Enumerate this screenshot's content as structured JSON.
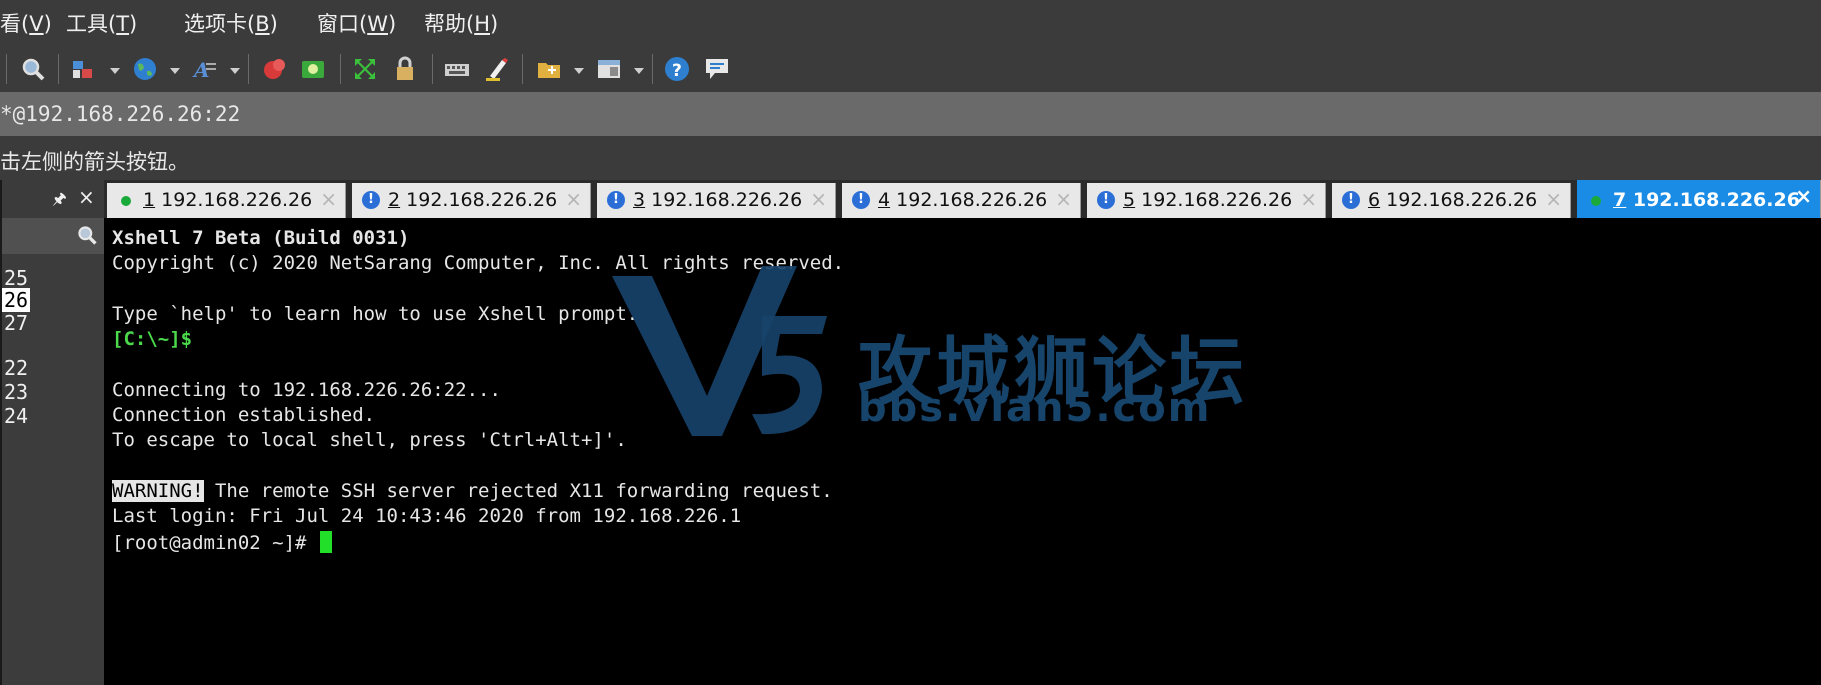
{
  "menu": {
    "items": [
      {
        "label": "看(",
        "key": "V",
        "tail": ")"
      },
      {
        "label": "工具(",
        "key": "T",
        "tail": ")"
      },
      {
        "label": "选项卡(",
        "key": "B",
        "tail": ")"
      },
      {
        "label": "窗口(",
        "key": "W",
        "tail": ")"
      },
      {
        "label": "帮助(",
        "key": "H",
        "tail": ")"
      }
    ]
  },
  "toolbar": {
    "icons": [
      "search-icon",
      "transfer-icon",
      "globe-icon",
      "font-icon",
      "xftp-icon",
      "xmanager-icon",
      "fullscreen-icon",
      "lock-icon",
      "keyboard-icon",
      "highlight-icon",
      "new-tab-icon",
      "layout-icon",
      "help-icon",
      "chat-icon"
    ]
  },
  "address": {
    "text": "*@192.168.226.26:22"
  },
  "hint": {
    "text": "击左侧的箭头按钮。"
  },
  "sidebar": {
    "pin": "📌",
    "close": "×",
    "items": [
      {
        "text": "25",
        "selected": false
      },
      {
        "text": "26",
        "selected": true
      },
      {
        "text": "27",
        "selected": false
      },
      {
        "text": "22",
        "selected": false
      },
      {
        "text": "23",
        "selected": false
      },
      {
        "text": "24",
        "selected": false
      }
    ]
  },
  "tabs": [
    {
      "num": "1",
      "host": "192.168.226.26",
      "status": "connected",
      "active": false
    },
    {
      "num": "2",
      "host": "192.168.226.26",
      "status": "warning",
      "active": false
    },
    {
      "num": "3",
      "host": "192.168.226.26",
      "status": "warning",
      "active": false
    },
    {
      "num": "4",
      "host": "192.168.226.26",
      "status": "warning",
      "active": false
    },
    {
      "num": "5",
      "host": "192.168.226.26",
      "status": "warning",
      "active": false
    },
    {
      "num": "6",
      "host": "192.168.226.26",
      "status": "warning",
      "active": false
    },
    {
      "num": "7",
      "host": "192.168.226.26",
      "status": "connected",
      "active": true
    }
  ],
  "terminal": {
    "line1": "Xshell 7 Beta (Build 0031)",
    "line2": "Copyright (c) 2020 NetSarang Computer, Inc. All rights reserved.",
    "line3": "Type `help' to learn how to use Xshell prompt.",
    "line4": "[C:\\~]$",
    "line5": "Connecting to 192.168.226.26:22...",
    "line6": "Connection established.",
    "line7": "To escape to local shell, press 'Ctrl+Alt+]'.",
    "warning_tag": "WARNING!",
    "line8_rest": " The remote SSH server rejected X11 forwarding request.",
    "line9": "Last login: Fri Jul 24 10:43:46 2020 from 192.168.226.1",
    "prompt": "[root@admin02 ~]# "
  },
  "watermark": {
    "title": "攻城狮论坛",
    "url": "bbs.vlan5.com"
  },
  "colors": {
    "accent": "#1a8ce6",
    "prompt_green": "#4bd84b",
    "cursor": "#22e02a"
  }
}
